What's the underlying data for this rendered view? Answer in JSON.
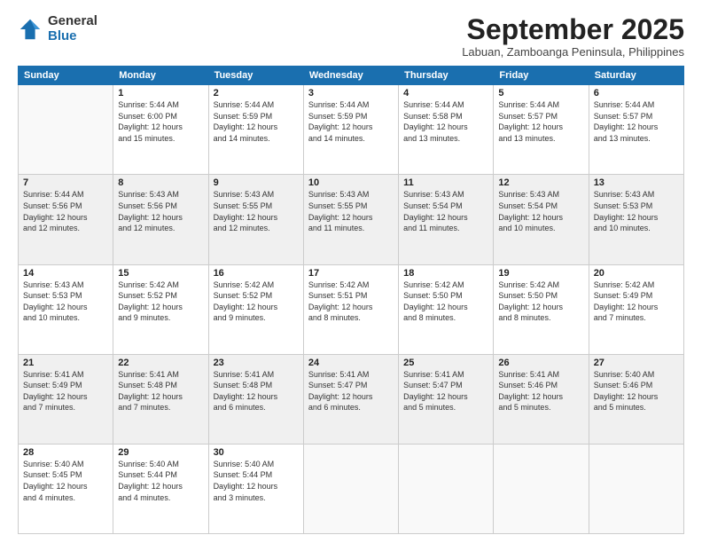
{
  "logo": {
    "general": "General",
    "blue": "Blue"
  },
  "title": "September 2025",
  "subtitle": "Labuan, Zamboanga Peninsula, Philippines",
  "weekdays": [
    "Sunday",
    "Monday",
    "Tuesday",
    "Wednesday",
    "Thursday",
    "Friday",
    "Saturday"
  ],
  "weeks": [
    [
      {
        "day": "",
        "info": ""
      },
      {
        "day": "1",
        "info": "Sunrise: 5:44 AM\nSunset: 6:00 PM\nDaylight: 12 hours\nand 15 minutes."
      },
      {
        "day": "2",
        "info": "Sunrise: 5:44 AM\nSunset: 5:59 PM\nDaylight: 12 hours\nand 14 minutes."
      },
      {
        "day": "3",
        "info": "Sunrise: 5:44 AM\nSunset: 5:59 PM\nDaylight: 12 hours\nand 14 minutes."
      },
      {
        "day": "4",
        "info": "Sunrise: 5:44 AM\nSunset: 5:58 PM\nDaylight: 12 hours\nand 13 minutes."
      },
      {
        "day": "5",
        "info": "Sunrise: 5:44 AM\nSunset: 5:57 PM\nDaylight: 12 hours\nand 13 minutes."
      },
      {
        "day": "6",
        "info": "Sunrise: 5:44 AM\nSunset: 5:57 PM\nDaylight: 12 hours\nand 13 minutes."
      }
    ],
    [
      {
        "day": "7",
        "info": "Sunrise: 5:44 AM\nSunset: 5:56 PM\nDaylight: 12 hours\nand 12 minutes."
      },
      {
        "day": "8",
        "info": "Sunrise: 5:43 AM\nSunset: 5:56 PM\nDaylight: 12 hours\nand 12 minutes."
      },
      {
        "day": "9",
        "info": "Sunrise: 5:43 AM\nSunset: 5:55 PM\nDaylight: 12 hours\nand 12 minutes."
      },
      {
        "day": "10",
        "info": "Sunrise: 5:43 AM\nSunset: 5:55 PM\nDaylight: 12 hours\nand 11 minutes."
      },
      {
        "day": "11",
        "info": "Sunrise: 5:43 AM\nSunset: 5:54 PM\nDaylight: 12 hours\nand 11 minutes."
      },
      {
        "day": "12",
        "info": "Sunrise: 5:43 AM\nSunset: 5:54 PM\nDaylight: 12 hours\nand 10 minutes."
      },
      {
        "day": "13",
        "info": "Sunrise: 5:43 AM\nSunset: 5:53 PM\nDaylight: 12 hours\nand 10 minutes."
      }
    ],
    [
      {
        "day": "14",
        "info": "Sunrise: 5:43 AM\nSunset: 5:53 PM\nDaylight: 12 hours\nand 10 minutes."
      },
      {
        "day": "15",
        "info": "Sunrise: 5:42 AM\nSunset: 5:52 PM\nDaylight: 12 hours\nand 9 minutes."
      },
      {
        "day": "16",
        "info": "Sunrise: 5:42 AM\nSunset: 5:52 PM\nDaylight: 12 hours\nand 9 minutes."
      },
      {
        "day": "17",
        "info": "Sunrise: 5:42 AM\nSunset: 5:51 PM\nDaylight: 12 hours\nand 8 minutes."
      },
      {
        "day": "18",
        "info": "Sunrise: 5:42 AM\nSunset: 5:50 PM\nDaylight: 12 hours\nand 8 minutes."
      },
      {
        "day": "19",
        "info": "Sunrise: 5:42 AM\nSunset: 5:50 PM\nDaylight: 12 hours\nand 8 minutes."
      },
      {
        "day": "20",
        "info": "Sunrise: 5:42 AM\nSunset: 5:49 PM\nDaylight: 12 hours\nand 7 minutes."
      }
    ],
    [
      {
        "day": "21",
        "info": "Sunrise: 5:41 AM\nSunset: 5:49 PM\nDaylight: 12 hours\nand 7 minutes."
      },
      {
        "day": "22",
        "info": "Sunrise: 5:41 AM\nSunset: 5:48 PM\nDaylight: 12 hours\nand 7 minutes."
      },
      {
        "day": "23",
        "info": "Sunrise: 5:41 AM\nSunset: 5:48 PM\nDaylight: 12 hours\nand 6 minutes."
      },
      {
        "day": "24",
        "info": "Sunrise: 5:41 AM\nSunset: 5:47 PM\nDaylight: 12 hours\nand 6 minutes."
      },
      {
        "day": "25",
        "info": "Sunrise: 5:41 AM\nSunset: 5:47 PM\nDaylight: 12 hours\nand 5 minutes."
      },
      {
        "day": "26",
        "info": "Sunrise: 5:41 AM\nSunset: 5:46 PM\nDaylight: 12 hours\nand 5 minutes."
      },
      {
        "day": "27",
        "info": "Sunrise: 5:40 AM\nSunset: 5:46 PM\nDaylight: 12 hours\nand 5 minutes."
      }
    ],
    [
      {
        "day": "28",
        "info": "Sunrise: 5:40 AM\nSunset: 5:45 PM\nDaylight: 12 hours\nand 4 minutes."
      },
      {
        "day": "29",
        "info": "Sunrise: 5:40 AM\nSunset: 5:44 PM\nDaylight: 12 hours\nand 4 minutes."
      },
      {
        "day": "30",
        "info": "Sunrise: 5:40 AM\nSunset: 5:44 PM\nDaylight: 12 hours\nand 3 minutes."
      },
      {
        "day": "",
        "info": ""
      },
      {
        "day": "",
        "info": ""
      },
      {
        "day": "",
        "info": ""
      },
      {
        "day": "",
        "info": ""
      }
    ]
  ]
}
